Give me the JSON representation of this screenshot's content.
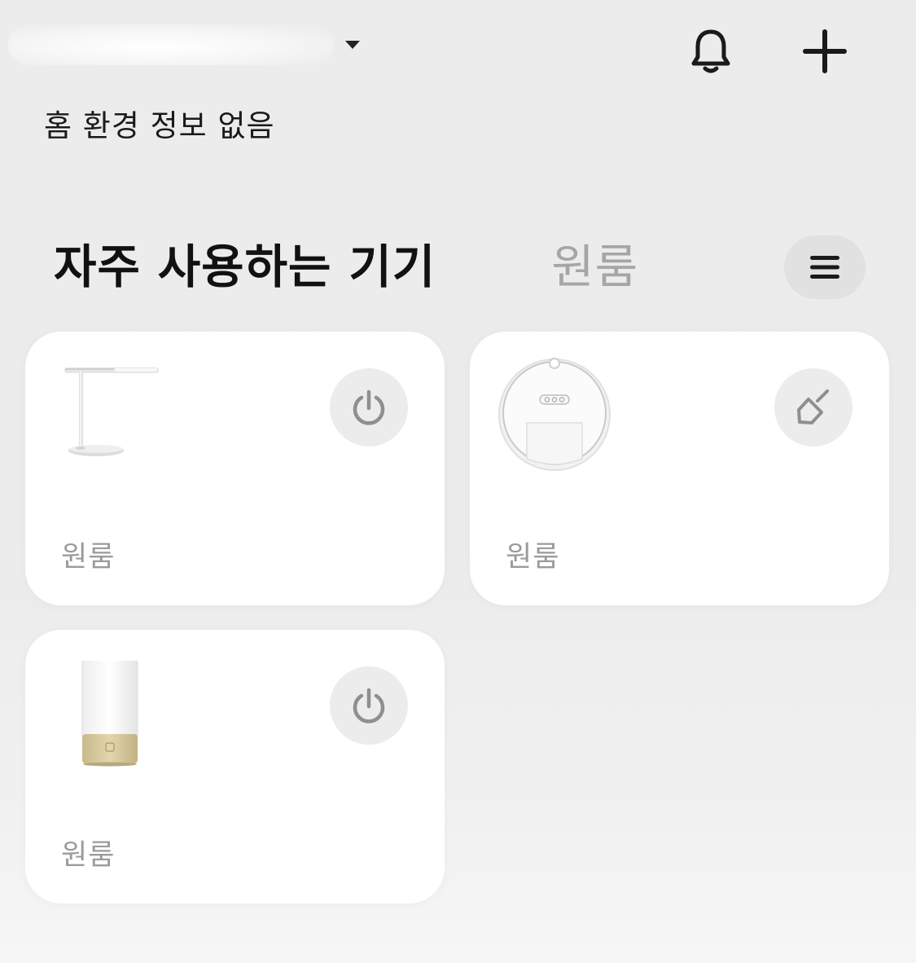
{
  "header": {
    "home_name": "",
    "bell_icon": "bell-icon",
    "add_icon": "plus-icon",
    "caret_icon": "caret-down-icon"
  },
  "env_info": "홈 환경 정보 없음",
  "tabs": [
    {
      "label": "자주 사용하는 기기",
      "active": true
    },
    {
      "label": "원룸",
      "active": false
    }
  ],
  "menu_icon": "hamburger-menu-icon",
  "devices": [
    {
      "name": "",
      "room": "원룸",
      "image": "desk-lamp",
      "action_icon": "power-icon"
    },
    {
      "name": "",
      "room": "원룸",
      "image": "robot-vacuum",
      "action_icon": "broom-icon"
    },
    {
      "name": "",
      "room": "원룸",
      "image": "bedside-lamp",
      "action_icon": "power-icon"
    }
  ],
  "colors": {
    "background": "#ebebeb",
    "card": "#ffffff",
    "action_button_bg": "#ececec",
    "icon_gray": "#8f8f8f",
    "tab_inactive": "#a6a6a6",
    "room_label": "#9b9b9b",
    "lamp_gold": "#d6c79a"
  }
}
